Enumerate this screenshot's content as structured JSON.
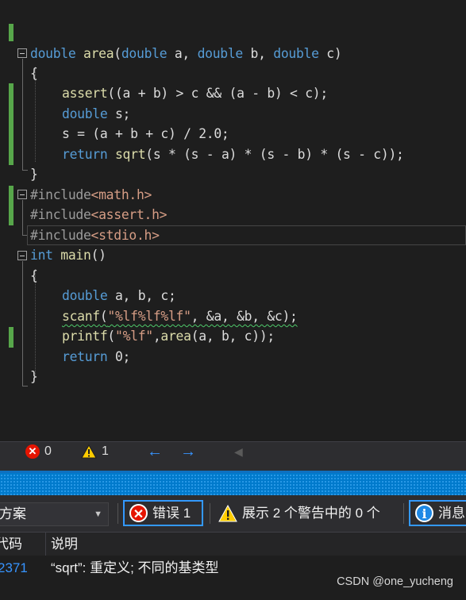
{
  "editor": {
    "code": {
      "area_sig": {
        "ret": "double",
        "name": "area",
        "open": "(",
        "t1": "double",
        "p1": " a, ",
        "t2": "double",
        "p2": " b, ",
        "t3": "double",
        "p3": " c)"
      },
      "brace_open": "{",
      "assert_line": {
        "fn": "assert",
        "rest": "((a + b) > c && (a - b) < c);"
      },
      "decl_s": {
        "kw": "double",
        "rest": " s;"
      },
      "calc_s": {
        "text": "s = (a + b + c) / 2.0;"
      },
      "return_sqrt": {
        "kw": "return",
        "fn": " sqrt",
        "rest": "(s * (s - a) * (s - b) * (s - c));"
      },
      "brace_close": "}",
      "inc_math": {
        "dir": "#include",
        "hdr": "<math.h>"
      },
      "inc_assert": {
        "dir": "#include",
        "hdr": "<assert.h>"
      },
      "inc_stdio": {
        "dir": "#include",
        "hdr": "<stdio.h>"
      },
      "main_sig": {
        "kw": "int",
        "name": " main",
        "rest": "()"
      },
      "main_open": "{",
      "decl_abc": {
        "kw": "double",
        "rest": " a, b, c;"
      },
      "scanf_line": {
        "fn": "scanf",
        "open": "(",
        "fmt": "\"%lf%lf%lf\"",
        "rest": ", &a, &b, &c);"
      },
      "printf_line": {
        "fn": "printf",
        "open": "(",
        "fmt": "\"%lf\"",
        "mid": ",",
        "fn2": "area",
        "rest": "(a, b, c));"
      },
      "return0": {
        "kw": "return",
        "rest": " 0;"
      },
      "main_close": "}"
    }
  },
  "status_strip": {
    "errors_count": "0",
    "warnings_count": "1",
    "err_icon": "error-circle-icon",
    "warn_icon": "warning-triangle-icon",
    "back_icon": "arrow-left-icon",
    "forward_icon": "arrow-right-icon"
  },
  "error_list": {
    "scope_value": "方案",
    "errors_filter": "错误 1",
    "warnings_filter": "展示 2 个警告中的 0 个",
    "messages_filter": "消息",
    "columns": {
      "code": "代码",
      "description": "说明"
    },
    "rows": [
      {
        "code": "2371",
        "description": "“sqrt”: 重定义; 不同的基类型"
      }
    ]
  },
  "watermark": "CSDN @one_yucheng",
  "colors": {
    "editor_bg": "#1e1e1e",
    "keyword": "#569cd6",
    "function": "#dcdcaa",
    "string": "#d69d85",
    "accent_blue": "#007acc",
    "error_red": "#e51400",
    "warning_yellow": "#ffcc00"
  }
}
